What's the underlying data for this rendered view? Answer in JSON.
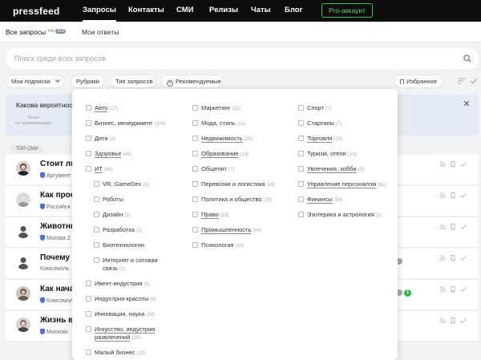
{
  "header": {
    "logo": "pressfeed",
    "nav": [
      "Запросы",
      "Контакты",
      "СМИ",
      "Релизы",
      "Чаты",
      "Блог"
    ],
    "pro_button": "Pro-аккаунт"
  },
  "subtabs": {
    "all_label": "Все запросы",
    "all_count": "446",
    "all_new": "410",
    "mine_label": "Мои ответы"
  },
  "search": {
    "placeholder": "Поиск среди всех запросов",
    "value": ""
  },
  "filters": {
    "subscriptions": "Мои подписки",
    "rubrics": "Рубрики",
    "request_type": "Тип запросов",
    "recommended": "Рекомендуемые",
    "favorites": "Избранное"
  },
  "banner": {
    "question": "Какова вероятнос",
    "scale_left_1": "Точно",
    "scale_left_2": "не порекомендую"
  },
  "list": {
    "section_label": "ТОП СМИ",
    "rows": [
      {
        "title": "Стоит ли",
        "source": "Аргумент"
      },
      {
        "title": "Как прос",
        "source": "Российск"
      },
      {
        "title": "Животны",
        "source": "Москва 2"
      },
      {
        "title": "Почему б",
        "source": "Комсомоль"
      },
      {
        "title": "Как нача",
        "source": "Комсомол"
      },
      {
        "title": "Жизнь в",
        "source": "Московс"
      }
    ],
    "badge_green": "1"
  },
  "rubrics": {
    "col1": [
      {
        "label": "Авто",
        "count": "(17)",
        "underline": true,
        "sub": false
      },
      {
        "label": "Бизнес, менеджмент",
        "count": "(104)",
        "underline": false,
        "sub": false
      },
      {
        "label": "Дети",
        "count": "(9)",
        "underline": false,
        "sub": false
      },
      {
        "label": "Здоровье",
        "count": "(49)",
        "underline": true,
        "sub": false
      },
      {
        "label": "ИТ",
        "count": "(45)",
        "underline": true,
        "sub": false
      },
      {
        "label": "VR, GameDev",
        "count": "(2)",
        "underline": false,
        "sub": true
      },
      {
        "label": "Роботы",
        "count": "",
        "underline": false,
        "sub": true
      },
      {
        "label": "Дизайн",
        "count": "(1)",
        "underline": false,
        "sub": true
      },
      {
        "label": "Разработка",
        "count": "(2)",
        "underline": false,
        "sub": true
      },
      {
        "label": "Биотехнологии",
        "count": "",
        "underline": false,
        "sub": true
      },
      {
        "label": "Интернет и сотовая связь",
        "count": "(1)",
        "underline": false,
        "sub": true
      },
      {
        "label": "Ивент-индустрия",
        "count": "(4)",
        "underline": false,
        "sub": false
      },
      {
        "label": "Индустрия красоты",
        "count": "(8)",
        "underline": false,
        "sub": false
      },
      {
        "label": "Инновации, наука",
        "count": "(34)",
        "underline": false,
        "sub": false
      },
      {
        "label": "Искусство, индустрия развлечений",
        "count": "(25)",
        "underline": true,
        "sub": false
      },
      {
        "label": "Малый бизнес",
        "count": "(22)",
        "underline": false,
        "sub": false
      }
    ],
    "col2": [
      {
        "label": "Маркетинг",
        "count": "(51)",
        "underline": false
      },
      {
        "label": "Мода, стиль",
        "count": "(11)",
        "underline": false
      },
      {
        "label": "Недвижимость",
        "count": "(25)",
        "underline": true
      },
      {
        "label": "Образование",
        "count": "(14)",
        "underline": true
      },
      {
        "label": "Общепит",
        "count": "(7)",
        "underline": false
      },
      {
        "label": "Перевозки и логистика",
        "count": "(14)",
        "underline": false
      },
      {
        "label": "Политика и общество",
        "count": "(29)",
        "underline": false
      },
      {
        "label": "Право",
        "count": "(23)",
        "underline": true
      },
      {
        "label": "Промышленность",
        "count": "(44)",
        "underline": true
      },
      {
        "label": "Психология",
        "count": "(19)",
        "underline": false
      }
    ],
    "col3": [
      {
        "label": "Спорт",
        "count": "(7)",
        "underline": false
      },
      {
        "label": "Стартапы",
        "count": "(7)",
        "underline": false
      },
      {
        "label": "Торговля",
        "count": "(13)",
        "underline": true
      },
      {
        "label": "Туризм, отели",
        "count": "(13)",
        "underline": false
      },
      {
        "label": "Увлечения, хобби",
        "count": "(5)",
        "underline": true
      },
      {
        "label": "Управление персоналом",
        "count": "(61)",
        "underline": true
      },
      {
        "label": "Финансы",
        "count": "(38)",
        "underline": true
      },
      {
        "label": "Эзотерика и астрология",
        "count": "(1)",
        "underline": false
      }
    ]
  },
  "colors": {
    "accent_green": "#3ac24a",
    "banner_bg": "#e4ebf4",
    "verified_blue": "#4a73d9"
  }
}
